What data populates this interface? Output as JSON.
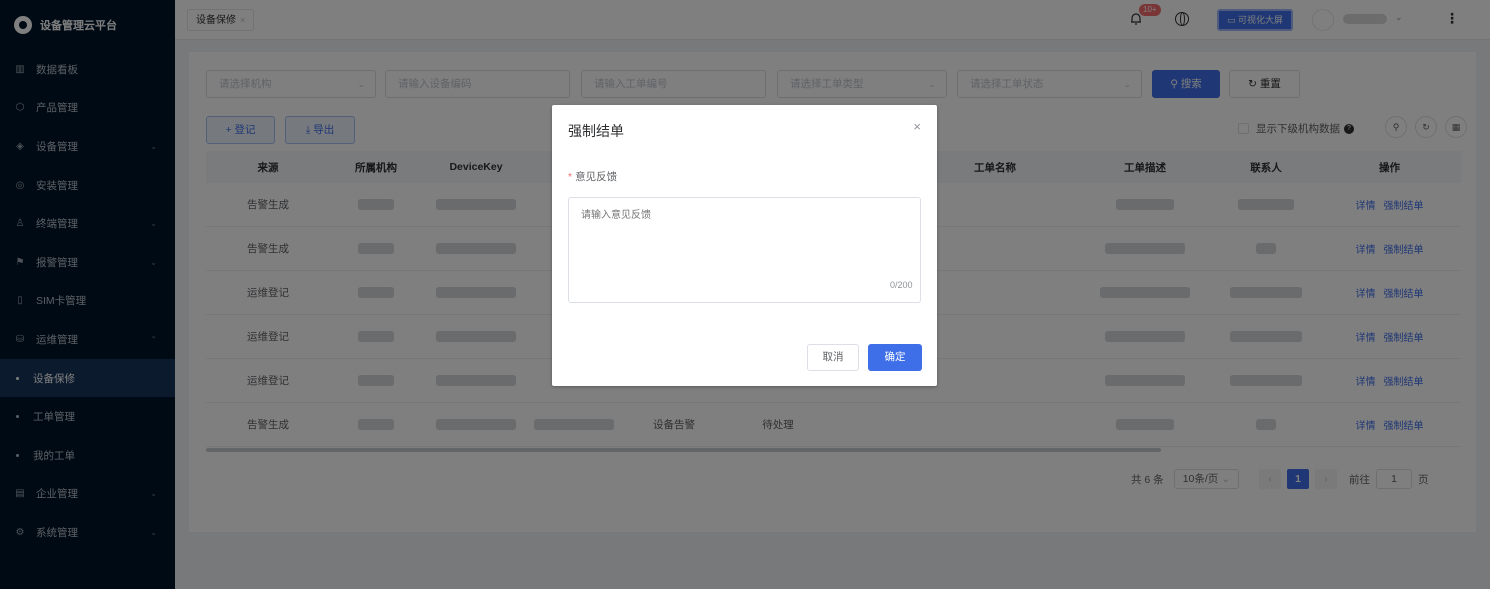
{
  "app": {
    "title": "设备管理云平台"
  },
  "sidebar": {
    "items": [
      {
        "label": "数据看板",
        "icon": "chart-icon",
        "arrow": false
      },
      {
        "label": "产品管理",
        "icon": "cube-icon",
        "arrow": false
      },
      {
        "label": "设备管理",
        "icon": "device-icon",
        "arrow": true
      },
      {
        "label": "安装管理",
        "icon": "install-icon",
        "arrow": false
      },
      {
        "label": "终端管理",
        "icon": "person-icon",
        "arrow": true
      },
      {
        "label": "报警管理",
        "icon": "alarm-icon",
        "arrow": true
      },
      {
        "label": "SIM卡管理",
        "icon": "sim-icon",
        "arrow": false
      },
      {
        "label": "运维管理",
        "icon": "ops-icon",
        "arrow": true,
        "expanded": true
      },
      {
        "label": "设备保修",
        "sub": true,
        "active": true
      },
      {
        "label": "工单管理",
        "sub": true
      },
      {
        "label": "我的工单",
        "sub": true
      },
      {
        "label": "企业管理",
        "icon": "company-icon",
        "arrow": true
      },
      {
        "label": "系统管理",
        "icon": "settings-icon",
        "arrow": true
      }
    ]
  },
  "topbar": {
    "tab": "设备保修",
    "badge": "10+",
    "bigscreen": "可视化大屏"
  },
  "filters": {
    "org": "请选择机构",
    "device": "请输入设备编码",
    "order_no": "请输入工单编号",
    "order_type": "请选择工单类型",
    "order_status": "请选择工单状态",
    "search": "搜索",
    "reset": "重置"
  },
  "toolbar": {
    "register": "登记",
    "export": "导出",
    "show_sub": "显示下级机构数据"
  },
  "table": {
    "headers": [
      "来源",
      "所属机构",
      "DeviceKey",
      "",
      "",
      "",
      "",
      "工单名称",
      "工单描述",
      "联系人",
      "操作"
    ],
    "rows": [
      {
        "source": "告警生成"
      },
      {
        "source": "告警生成"
      },
      {
        "source": "运维登记"
      },
      {
        "source": "运维登记"
      },
      {
        "source": "运维登记"
      },
      {
        "source": "告警生成",
        "alarm_type": "设备告警",
        "status": "待处理"
      }
    ],
    "action_detail": "详情",
    "action_force": "强制结单"
  },
  "pagination": {
    "total": "共 6 条",
    "page_size": "10条/页",
    "current": "1",
    "goto_prefix": "前往",
    "goto_value": "1",
    "goto_suffix": "页"
  },
  "dialog": {
    "title": "强制结单",
    "label": "意见反馈",
    "placeholder": "请输入意见反馈",
    "counter": "0/200",
    "cancel": "取消",
    "confirm": "确定"
  }
}
